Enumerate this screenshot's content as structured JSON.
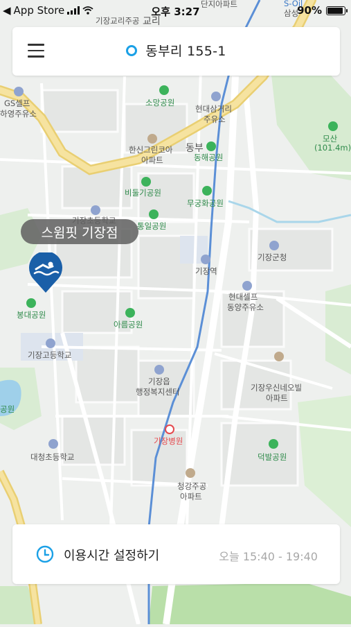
{
  "status_bar": {
    "back_app": "App Store",
    "time": "오후 3:27",
    "battery": "90%"
  },
  "header": {
    "location": "동부리 155-1"
  },
  "map": {
    "selected_place": "스윔핏 기장점",
    "labels": {
      "top_danji": "단지아파트",
      "top_kijang_goli": "기장교리주공",
      "top_gyori": "교리",
      "samsung": "삼성",
      "s_oil": "S-Oil",
      "gs_self": "GS셀프",
      "hayoung": "하영주유소",
      "somang": "소망공원",
      "hyundai_samgeori_1": "현대삼거리",
      "hyundai_samgeori_2": "주유소",
      "hanshin_1": "한신그린코아",
      "hanshin_2": "아파트",
      "dongbu": "동부",
      "donghae": "동해공원",
      "mosan": "모산",
      "mosan_height": "(101.4m)",
      "bidulgi": "비둘기공원",
      "mugunghwa": "무궁화공원",
      "kijang_cho_top": "기장초등학교",
      "tongil": "통일공원",
      "kijang_station": "기장역",
      "kijang_gun": "기장군청",
      "hyundai_self_1": "현대셀프",
      "hyundai_self_2": "동양주유소",
      "bongdae": "봉대공원",
      "areum": "아름공원",
      "kijang_high": "기장고등학교",
      "kijang_eup_1": "기장읍",
      "kijang_eup_2": "행정복지센터",
      "woosin_1": "기장우신네오빌",
      "woosin_2": "아파트",
      "park_left": "공원",
      "kijang_hospital": "기장병원",
      "deokbal": "덕발공원",
      "daecheong": "대청초등학교",
      "cheonggang_1": "청강주공",
      "cheonggang_2": "아파트"
    }
  },
  "bottom": {
    "label": "이용시간 설정하기",
    "value": "오늘 15:40 - 19:40"
  },
  "colors": {
    "accent": "#1aa0e6",
    "pin": "#1a5fa8",
    "road_yellow": "#f3dc86",
    "rail_blue": "#5b8fd6"
  }
}
